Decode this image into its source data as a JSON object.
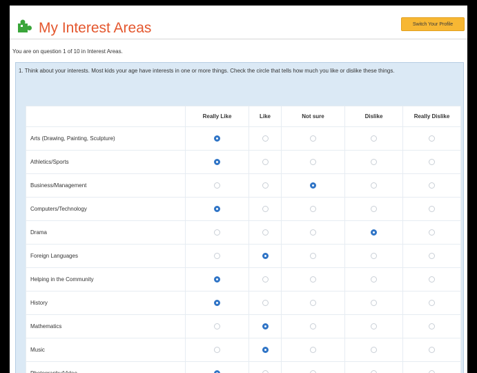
{
  "header": {
    "title": "My Interest Areas",
    "switch_button": "Switch Your Profile"
  },
  "progress_text": "You are on question 1 of 10 in Interest Areas.",
  "question_text": "1. Think about your interests. Most kids your age have interests in one or more things. Check the circle that tells how much you like or dislike these things.",
  "columns": [
    "",
    "Really Like",
    "Like",
    "Not sure",
    "Dislike",
    "Really Dislike"
  ],
  "rows": [
    {
      "label": "Arts (Drawing, Painting, Sculpture)",
      "selected": 0
    },
    {
      "label": "Athletics/Sports",
      "selected": 0
    },
    {
      "label": "Business/Management",
      "selected": 2
    },
    {
      "label": "Computers/Technology",
      "selected": 0
    },
    {
      "label": "Drama",
      "selected": 3
    },
    {
      "label": "Foreign Languages",
      "selected": 1
    },
    {
      "label": "Helping in the Community",
      "selected": 0
    },
    {
      "label": "History",
      "selected": 0
    },
    {
      "label": "Mathematics",
      "selected": 1
    },
    {
      "label": "Music",
      "selected": 1
    },
    {
      "label": "Photography/Video",
      "selected": 0
    }
  ],
  "colors": {
    "title": "#e4572e",
    "icon_green": "#3aa63a",
    "button": "#f7b733",
    "panel": "#dbe9f5",
    "radio_selected": "#2f74c6"
  },
  "icons": {
    "logo": "puzzle-piece-icon"
  }
}
